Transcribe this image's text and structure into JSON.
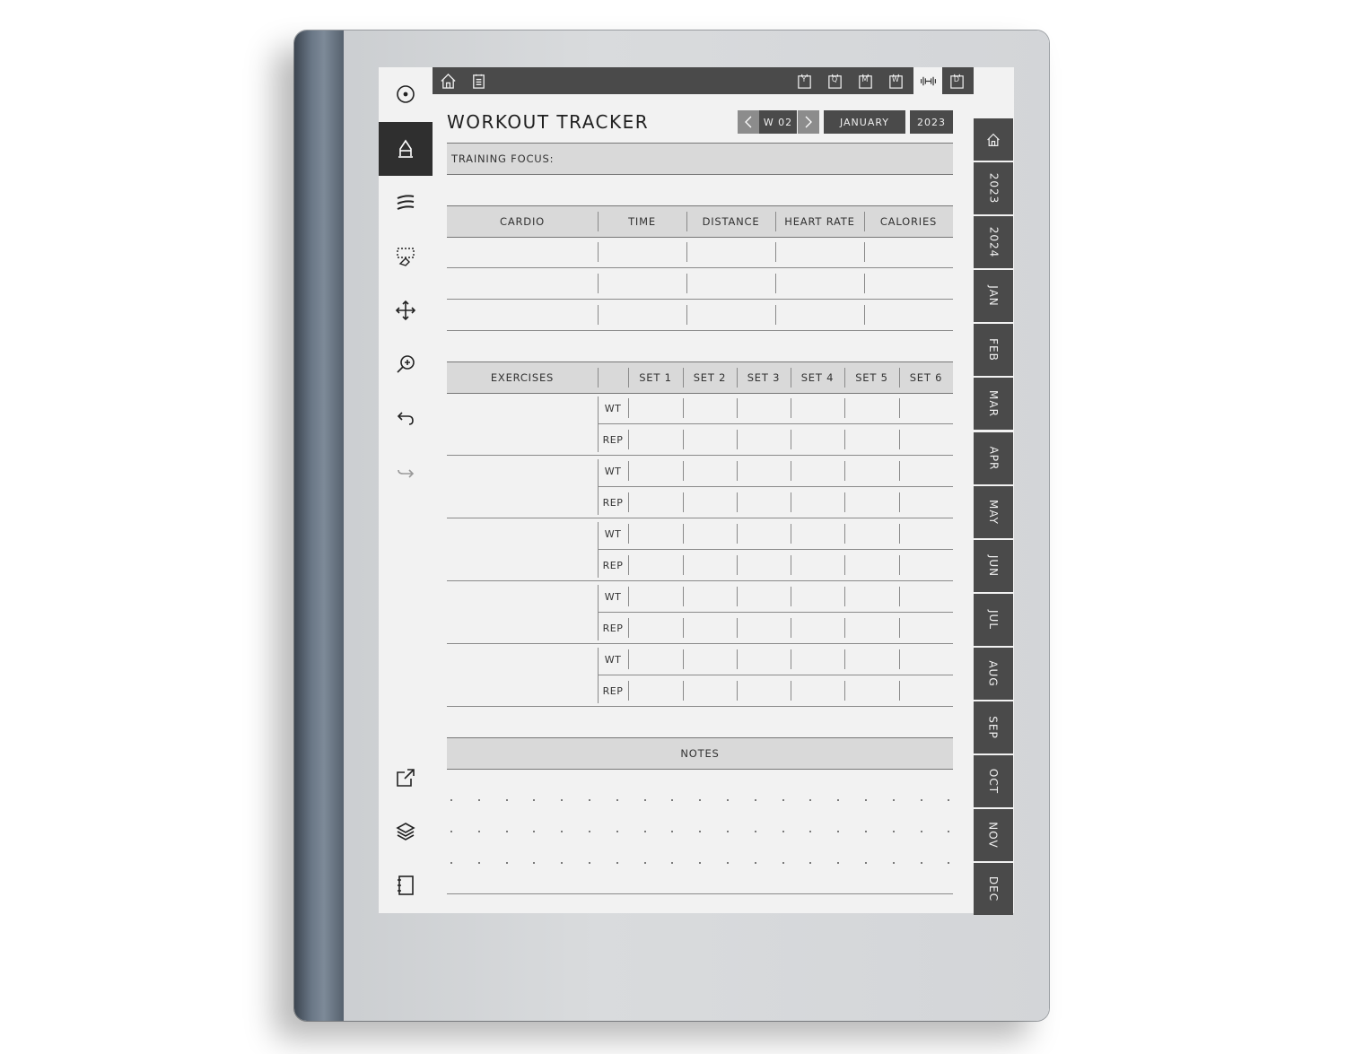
{
  "toolbar": {
    "icons": [
      "menu-circle-icon",
      "pen-icon",
      "strokes-icon",
      "selection-eraser-icon",
      "move-icon",
      "zoom-icon",
      "undo-icon",
      "redo-icon",
      "share-icon",
      "layers-icon",
      "notebook-icon"
    ]
  },
  "topbar": {
    "left_icons": [
      "home-icon",
      "notes-icon"
    ],
    "right_items": [
      {
        "icon": "calendar-year-icon",
        "letter": "Y"
      },
      {
        "icon": "calendar-quarter-icon",
        "letter": "Q"
      },
      {
        "icon": "calendar-month-icon",
        "letter": "M"
      },
      {
        "icon": "calendar-week-icon",
        "letter": "W"
      },
      {
        "icon": "dumbbell-icon",
        "letter": ""
      },
      {
        "icon": "calendar-day-icon",
        "letter": "D"
      }
    ]
  },
  "header": {
    "title": "WORKOUT TRACKER",
    "week": "W 02",
    "month": "JANUARY",
    "year": "2023"
  },
  "training_focus_label": "TRAINING FOCUS:",
  "cardio": {
    "columns": [
      "CARDIO",
      "TIME",
      "DISTANCE",
      "HEART RATE",
      "CALORIES"
    ],
    "rows": 3
  },
  "exercises": {
    "columns": [
      "EXERCISES",
      "",
      "SET 1",
      "SET 2",
      "SET 3",
      "SET 4",
      "SET 5",
      "SET 6"
    ],
    "row_labels": [
      "WT",
      "REP"
    ],
    "count": 5
  },
  "notes_label": "NOTES",
  "right_tabs": [
    "2023",
    "2024",
    "JAN",
    "FEB",
    "MAR",
    "APR",
    "MAY",
    "JUN",
    "JUL",
    "AUG",
    "SEP",
    "OCT",
    "NOV",
    "DEC"
  ],
  "colors": {
    "dark": "#4a4a4a",
    "header_gray": "#d9d9d9",
    "screen": "#f2f2f2"
  }
}
